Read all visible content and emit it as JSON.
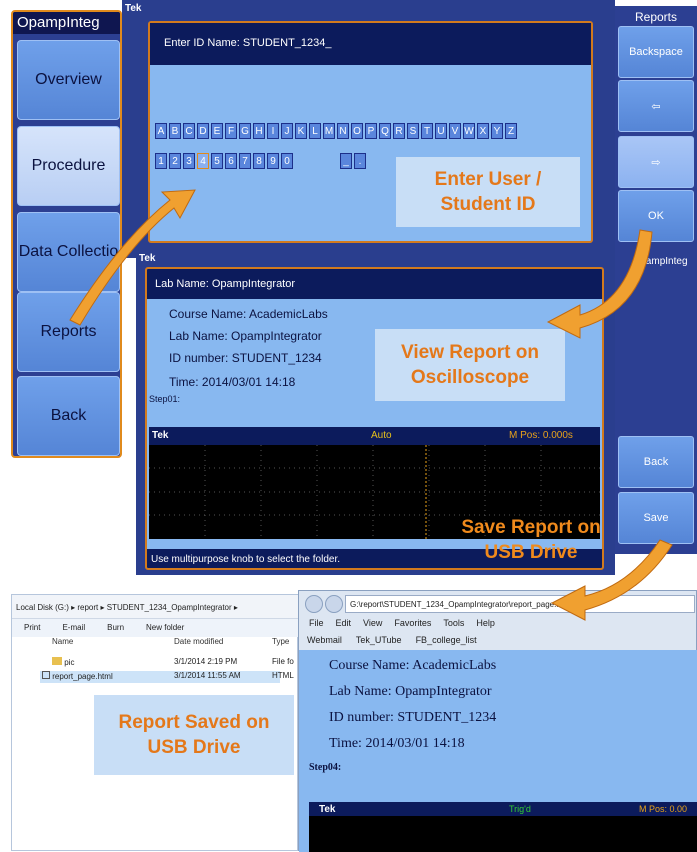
{
  "left_menu": {
    "title": "OpampInteg",
    "buttons": [
      "Overview",
      "Procedure",
      "Data Collectio",
      "Reports",
      "Back"
    ]
  },
  "top_screen": {
    "tek_label": "Tek",
    "id_prompt": "Enter ID Name:  STUDENT_1234_",
    "keyboard_letters": [
      "A",
      "B",
      "C",
      "D",
      "E",
      "F",
      "G",
      "H",
      "I",
      "J",
      "K",
      "L",
      "M",
      "N",
      "O",
      "P",
      "Q",
      "R",
      "S",
      "T",
      "U",
      "V",
      "W",
      "X",
      "Y",
      "Z"
    ],
    "keyboard_digits": [
      "1",
      "2",
      "3",
      "4",
      "5",
      "6",
      "7",
      "8",
      "9",
      "0"
    ],
    "keyboard_symbols": [
      "_",
      "."
    ],
    "callout": "Enter User / Student ID"
  },
  "right_menu": {
    "title": "Reports",
    "buttons": [
      "Backspace",
      "⇦",
      "⇨",
      "OK",
      "Back",
      "Save"
    ],
    "lower_title": "OpampInteg"
  },
  "report_screen": {
    "tek_label": "Tek",
    "lab_bar": "Lab Name: OpampIntegrator",
    "lines": [
      "Course Name: AcademicLabs",
      "Lab Name: OpampIntegrator",
      "ID number: STUDENT_1234",
      "Time: 2014/03/01 14:18"
    ],
    "step": "Step01:",
    "callout": "View Report on Oscilloscope",
    "wave_tek": "Tek",
    "wave_trigger": "Auto",
    "wave_mpos": "M Pos: 0.000s",
    "status": "Use multipurpose knob to select the folder.",
    "save_callout": "Save Report on USB Drive"
  },
  "explorer": {
    "path": "Local Disk (G:)  ▸  report  ▸  STUDENT_1234_OpampIntegrator  ▸",
    "toolbar": [
      "Print",
      "E-mail",
      "Burn",
      "New folder"
    ],
    "columns": [
      "Name",
      "Date modified",
      "Type"
    ],
    "rows": [
      {
        "name": "pic",
        "date": "3/1/2014 2:19 PM",
        "type": "File fo"
      },
      {
        "name": "report_page.html",
        "date": "3/1/2014 11:55 AM",
        "type": "HTML"
      }
    ],
    "callout": "Report Saved on USB Drive"
  },
  "browser": {
    "address": "G:\\report\\STUDENT_1234_OpampIntegrator\\report_page.html",
    "menu": [
      "File",
      "Edit",
      "View",
      "Favorites",
      "Tools",
      "Help"
    ],
    "favorites": [
      "Webmail",
      "Tek_UTube",
      "FB_college_list"
    ],
    "lines": [
      "Course Name: AcademicLabs",
      "Lab Name: OpampIntegrator",
      "ID number: STUDENT_1234",
      "Time: 2014/03/01 14:18"
    ],
    "step": "Step04:",
    "wave_tek": "Tek",
    "wave_trigger": "Trig'd",
    "wave_mpos": "M Pos: 0.00"
  },
  "colors": {
    "orange": "#e4781a",
    "navy": "#0c1b5c",
    "panel_blue": "#88b8f0"
  }
}
